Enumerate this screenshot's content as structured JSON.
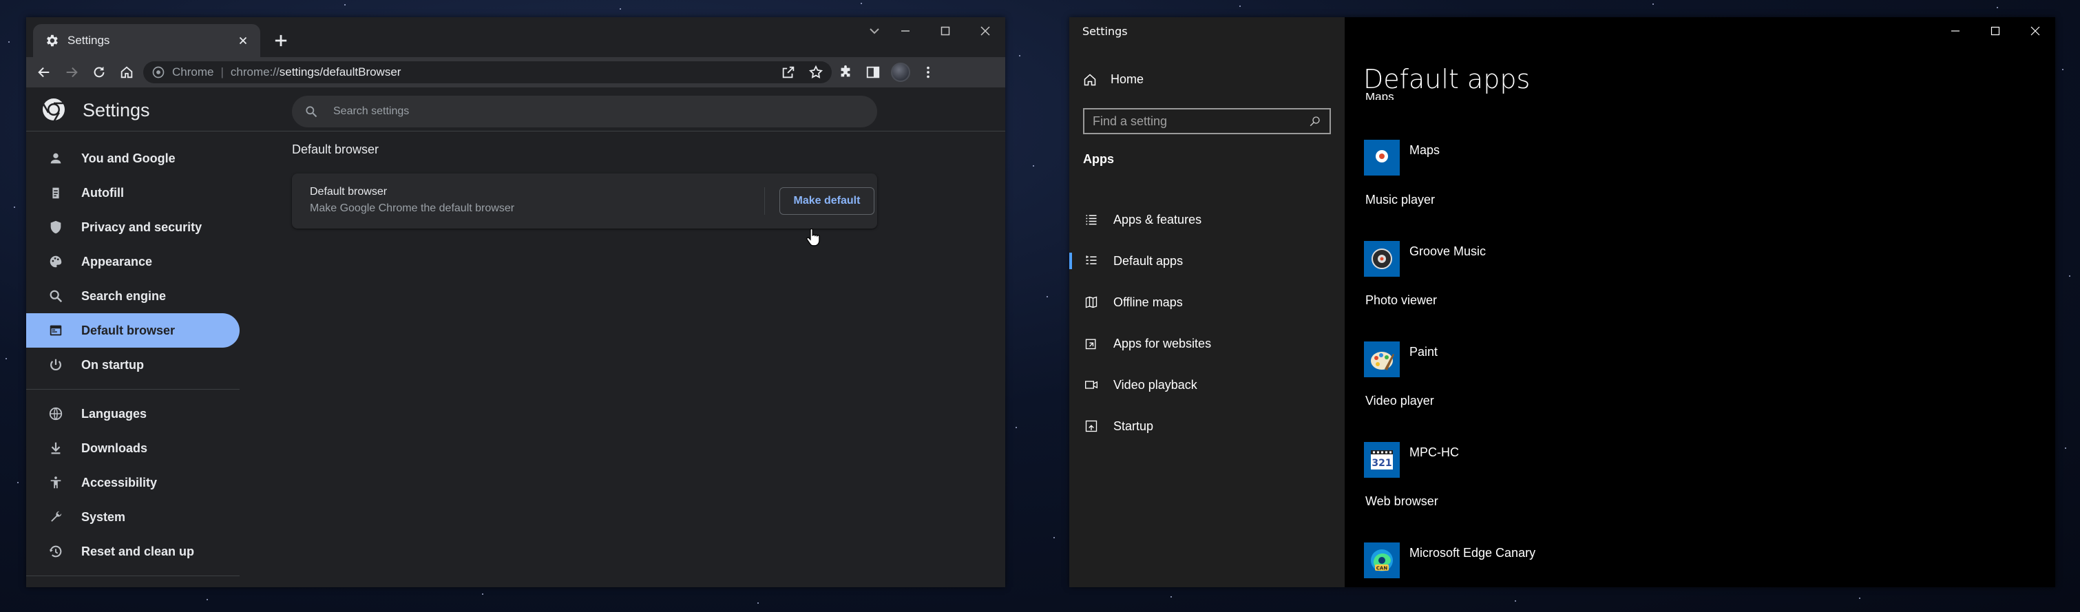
{
  "chrome": {
    "tab_title": "Settings",
    "url_host": "Chrome",
    "url_prefix": "chrome://",
    "url_rest": "settings/defaultBrowser",
    "settings_title": "Settings",
    "search_placeholder": "Search settings",
    "nav_items": [
      {
        "label": "You and Google",
        "icon": "person-icon"
      },
      {
        "label": "Autofill",
        "icon": "clipboard-icon"
      },
      {
        "label": "Privacy and security",
        "icon": "shield-icon"
      },
      {
        "label": "Appearance",
        "icon": "palette-icon"
      },
      {
        "label": "Search engine",
        "icon": "search-icon"
      },
      {
        "label": "Default browser",
        "icon": "browser-icon",
        "active": true
      },
      {
        "label": "On startup",
        "icon": "power-icon"
      }
    ],
    "nav_items_advanced": [
      {
        "label": "Languages",
        "icon": "globe-icon"
      },
      {
        "label": "Downloads",
        "icon": "download-icon"
      },
      {
        "label": "Accessibility",
        "icon": "accessibility-icon"
      },
      {
        "label": "System",
        "icon": "wrench-icon"
      },
      {
        "label": "Reset and clean up",
        "icon": "history-icon"
      }
    ],
    "section_title": "Default browser",
    "card_title": "Default browser",
    "card_desc": "Make Google Chrome the default browser",
    "make_default_label": "Make default",
    "accent_color": "#8ab4f8"
  },
  "windows_settings": {
    "window_title": "Settings",
    "home_label": "Home",
    "find_placeholder": "Find a setting",
    "apps_heading": "Apps",
    "nav_items": [
      {
        "label": "Apps & features",
        "icon": "list-icon"
      },
      {
        "label": "Default apps",
        "icon": "default-apps-icon",
        "selected": true
      },
      {
        "label": "Offline maps",
        "icon": "map-icon"
      },
      {
        "label": "Apps for websites",
        "icon": "open-external-icon"
      },
      {
        "label": "Video playback",
        "icon": "video-icon"
      },
      {
        "label": "Startup",
        "icon": "startup-icon"
      }
    ],
    "page_title": "Default apps",
    "clipped_category": "Maps",
    "defaults": [
      {
        "category": "",
        "app": "Maps",
        "icon": "maps-app-icon"
      },
      {
        "category": "Music player",
        "app": "Groove Music",
        "icon": "groove-music-icon"
      },
      {
        "category": "Photo viewer",
        "app": "Paint",
        "icon": "paint-icon"
      },
      {
        "category": "Video player",
        "app": "MPC-HC",
        "icon": "mpc-hc-icon"
      },
      {
        "category": "Web browser",
        "app": "Microsoft Edge Canary",
        "icon": "edge-canary-icon"
      }
    ],
    "accent_color": "#0063b1"
  }
}
